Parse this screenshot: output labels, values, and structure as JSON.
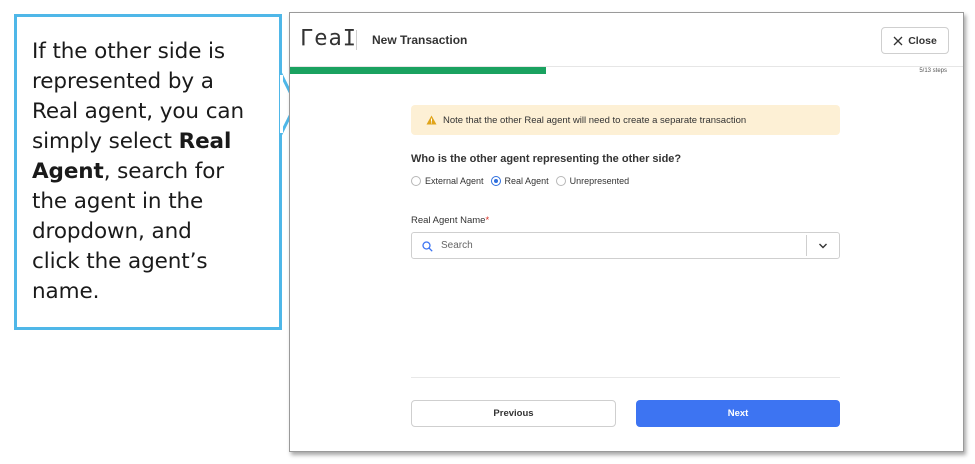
{
  "callout": {
    "line1": "If the other side is",
    "line2": "represented by a",
    "line3": "Real agent, you can",
    "line4_pre": "simply select ",
    "line4_bold": "Real",
    "line5_bold": "Agent",
    "line5_post": ", search for",
    "line6": "the agent in the",
    "line7": "dropdown, and",
    "line8": "click the agent’s",
    "line9": "name."
  },
  "header": {
    "logo": "ΓeaΙ",
    "title": "New Transaction",
    "close_label": "Close"
  },
  "progress": {
    "fraction": 0.38,
    "steps_text": "5/13 steps",
    "color": "#1aa260"
  },
  "notice": {
    "icon": "warning-icon",
    "text": "Note that the other Real agent will need to create a separate transaction"
  },
  "form": {
    "question": "Who is the other agent representing the other side?",
    "options": [
      {
        "label": "External Agent",
        "selected": false
      },
      {
        "label": "Real Agent",
        "selected": true
      },
      {
        "label": "Unrepresented",
        "selected": false
      }
    ],
    "field_label": "Real Agent Name",
    "required_mark": "*",
    "search_placeholder": "Search"
  },
  "footer": {
    "previous_label": "Previous",
    "next_label": "Next",
    "accent": "#3d74f2"
  }
}
